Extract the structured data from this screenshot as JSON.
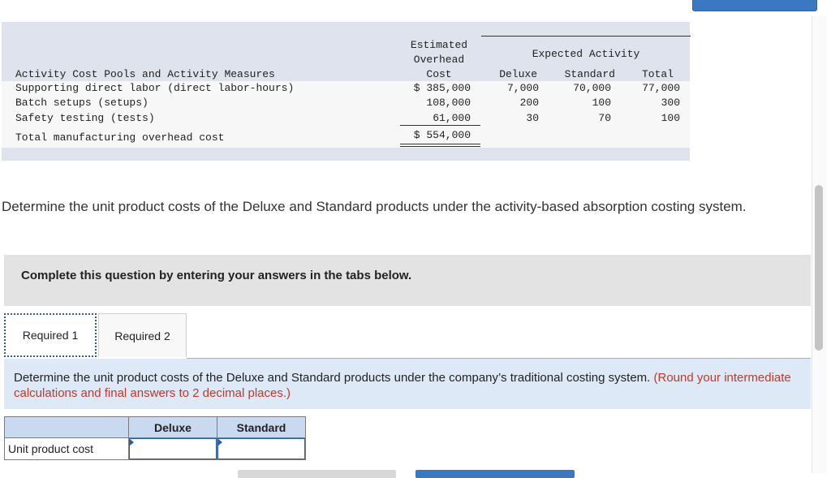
{
  "data_table": {
    "expected_activity_label": "Expected Activity",
    "col_headers": {
      "overhead_line1": "Estimated",
      "overhead_line2": "Overhead",
      "overhead_line3": "Cost",
      "deluxe": "Deluxe",
      "standard": "Standard",
      "total": "Total"
    },
    "row_header": "Activity Cost Pools and Activity Measures",
    "rows": [
      {
        "label": "Supporting direct labor (direct labor-hours)",
        "cost": "$ 385,000",
        "deluxe": "7,000",
        "standard": "70,000",
        "total": "77,000"
      },
      {
        "label": "Batch setups (setups)",
        "cost": "108,000",
        "deluxe": "200",
        "standard": "100",
        "total": "300"
      },
      {
        "label": "Safety testing (tests)",
        "cost": "61,000",
        "deluxe": "30",
        "standard": "70",
        "total": "100"
      }
    ],
    "total_row": {
      "label": "Total manufacturing overhead cost",
      "cost": "$ 554,000"
    }
  },
  "question": "Determine the unit product costs of the Deluxe and Standard products under the activity-based absorption costing system.",
  "instructions": "Complete this question by entering your answers in the tabs below.",
  "tabs": [
    {
      "label": "Required 1"
    },
    {
      "label": "Required 2"
    }
  ],
  "required": {
    "text": "Determine the unit product costs of the Deluxe and Standard products under the company’s traditional costing system.",
    "note": "(Round your intermediate calculations and final answers to 2 decimal places.)"
  },
  "answer_table": {
    "headers": [
      "Deluxe",
      "Standard"
    ],
    "row_label": "Unit product cost",
    "deluxe_value": "",
    "standard_value": ""
  }
}
